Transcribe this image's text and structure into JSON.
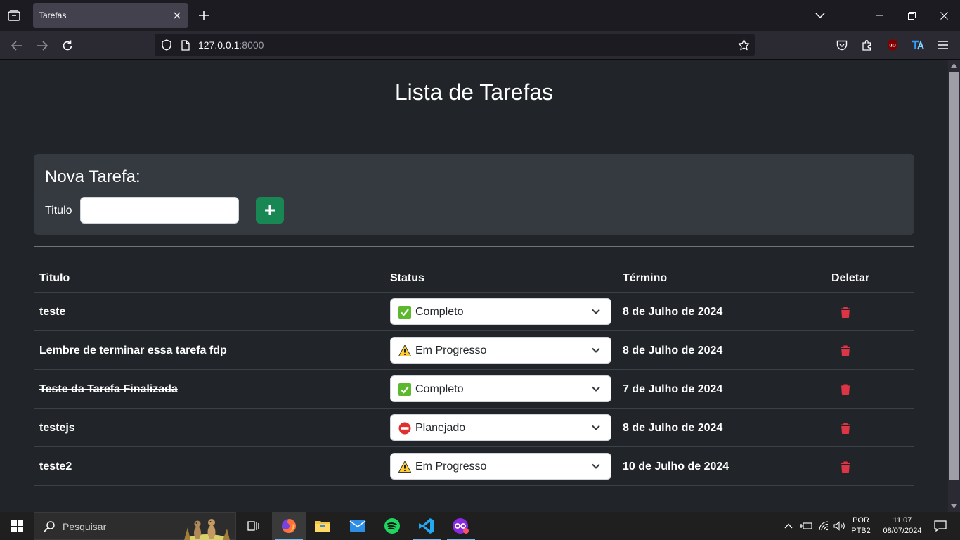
{
  "browser": {
    "tab_title": "Tarefas",
    "url_host": "127.0.0.1",
    "url_port": ":8000"
  },
  "page": {
    "title": "Lista de Tarefas",
    "new_task": {
      "heading": "Nova Tarefa:",
      "field_label": "Titulo",
      "field_value": "",
      "add_button": "+"
    },
    "table": {
      "headers": {
        "title": "Titulo",
        "status": "Status",
        "end": "Término",
        "delete": "Deletar"
      },
      "rows": [
        {
          "title": "teste",
          "status": "Completo",
          "status_icon": "check-icon",
          "date": "8 de Julho de 2024",
          "done": false
        },
        {
          "title": "Lembre de terminar essa tarefa fdp",
          "status": "Em Progresso",
          "status_icon": "warning-icon",
          "date": "8 de Julho de 2024",
          "done": false
        },
        {
          "title": "Teste da Tarefa Finalizada",
          "status": "Completo",
          "status_icon": "check-icon",
          "date": "7 de Julho de 2024",
          "done": true
        },
        {
          "title": "testejs",
          "status": "Planejado",
          "status_icon": "no-entry-icon",
          "date": "8 de Julho de 2024",
          "done": false
        },
        {
          "title": "teste2",
          "status": "Em Progresso",
          "status_icon": "warning-icon",
          "date": "10 de Julho de 2024",
          "done": false
        }
      ]
    }
  },
  "taskbar": {
    "search_placeholder": "Pesquisar",
    "lang_line1": "POR",
    "lang_line2": "PTB2",
    "time": "11:07",
    "date": "08/07/2024"
  },
  "colors": {
    "page_bg": "#212529",
    "card_bg": "#343a40",
    "success": "#198754",
    "danger": "#dc3545"
  }
}
